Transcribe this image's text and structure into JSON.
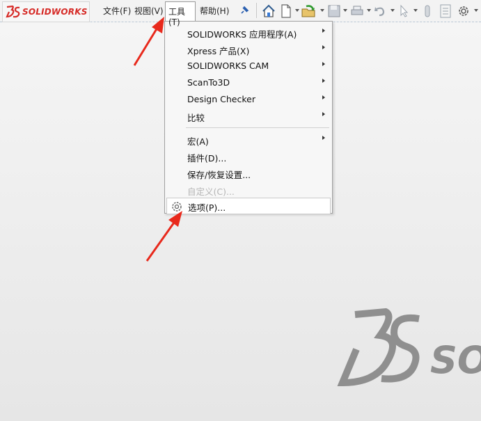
{
  "app": {
    "logo_text": "SOLIDWORKS"
  },
  "menubar": {
    "items": [
      {
        "label": "文件(F)"
      },
      {
        "label": "视图(V)"
      },
      {
        "label": "工具(T)"
      },
      {
        "label": "帮助(H)"
      }
    ]
  },
  "toolbar": {
    "icons": [
      "pin-icon",
      "home-icon",
      "new-document-icon",
      "open-icon",
      "save-icon",
      "print-icon",
      "undo-icon",
      "select-icon",
      "rebuild-icon",
      "file-properties-icon",
      "options-gear-icon"
    ]
  },
  "tools_menu": {
    "items": [
      {
        "label": "SOLIDWORKS 应用程序(A)",
        "submenu": true
      },
      {
        "label": "Xpress 产品(X)",
        "submenu": true
      },
      {
        "label": "SOLIDWORKS CAM",
        "submenu": true
      },
      {
        "label": "ScanTo3D",
        "submenu": true
      },
      {
        "label": "Design Checker",
        "submenu": true
      },
      {
        "label": "比较",
        "submenu": true
      },
      {
        "label": "宏(A)",
        "submenu": true
      },
      {
        "label": "插件(D)...",
        "submenu": false
      },
      {
        "label": "保存/恢复设置...",
        "submenu": false
      },
      {
        "label": "自定义(C)...",
        "submenu": false,
        "disabled": true
      },
      {
        "label": "选项(P)...",
        "submenu": false,
        "highlighted": true,
        "icon": "gear-icon"
      }
    ]
  },
  "annotations": {
    "color": "#e8291c"
  },
  "watermark": {
    "text": "SOL"
  }
}
